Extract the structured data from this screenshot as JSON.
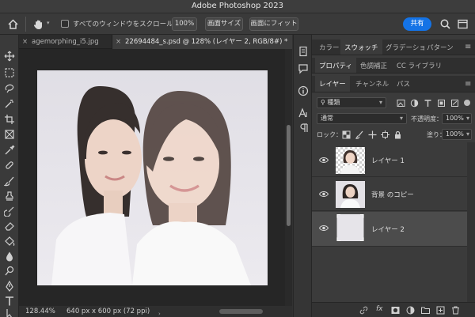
{
  "app": {
    "title": "Adobe Photoshop 2023"
  },
  "options_bar": {
    "scroll_all_windows_label": "すべてのウィンドウをスクロール",
    "zoom_value": "100%",
    "fit_screen_label": "画面サイズ",
    "fill_screen_label": "画面にフィット",
    "share_label": "共有"
  },
  "document_tabs": [
    {
      "label": "agemorphing_i5.jpg",
      "active": false
    },
    {
      "label": "22694484_s.psd @ 128% (レイヤー 2, RGB/8#) *",
      "active": true
    }
  ],
  "status_bar": {
    "zoom": "128.44%",
    "dimensions": "640 px x 600 px (72 ppi)"
  },
  "panels": {
    "row1_tabs": [
      "カラー",
      "スウォッチ",
      "グラデーショ",
      "パターン"
    ],
    "row1_active": 1,
    "row2_tabs": [
      "プロパティ",
      "色調補正",
      "CC ライブラリ"
    ],
    "row2_active": 0,
    "row3_tabs": [
      "レイヤー",
      "チャンネル",
      "パス"
    ],
    "row3_active": 0
  },
  "layers_panel": {
    "filter_kind": "種類",
    "blend_mode": "通常",
    "opacity_label": "不透明度：",
    "opacity_value": "100%",
    "lock_label": "ロック：",
    "fill_label": "塗り：",
    "fill_value": "100%",
    "layers": [
      {
        "name": "レイヤー 1",
        "visible": true,
        "selected": false,
        "thumb": "portrait-transparent"
      },
      {
        "name": "背景 のコピー",
        "visible": true,
        "selected": false,
        "thumb": "portrait-young"
      },
      {
        "name": "レイヤー 2",
        "visible": true,
        "selected": true,
        "thumb": "empty-gray"
      }
    ]
  },
  "colors": {
    "accent": "#1473e6",
    "selected_layer": "#4c4c4c"
  }
}
